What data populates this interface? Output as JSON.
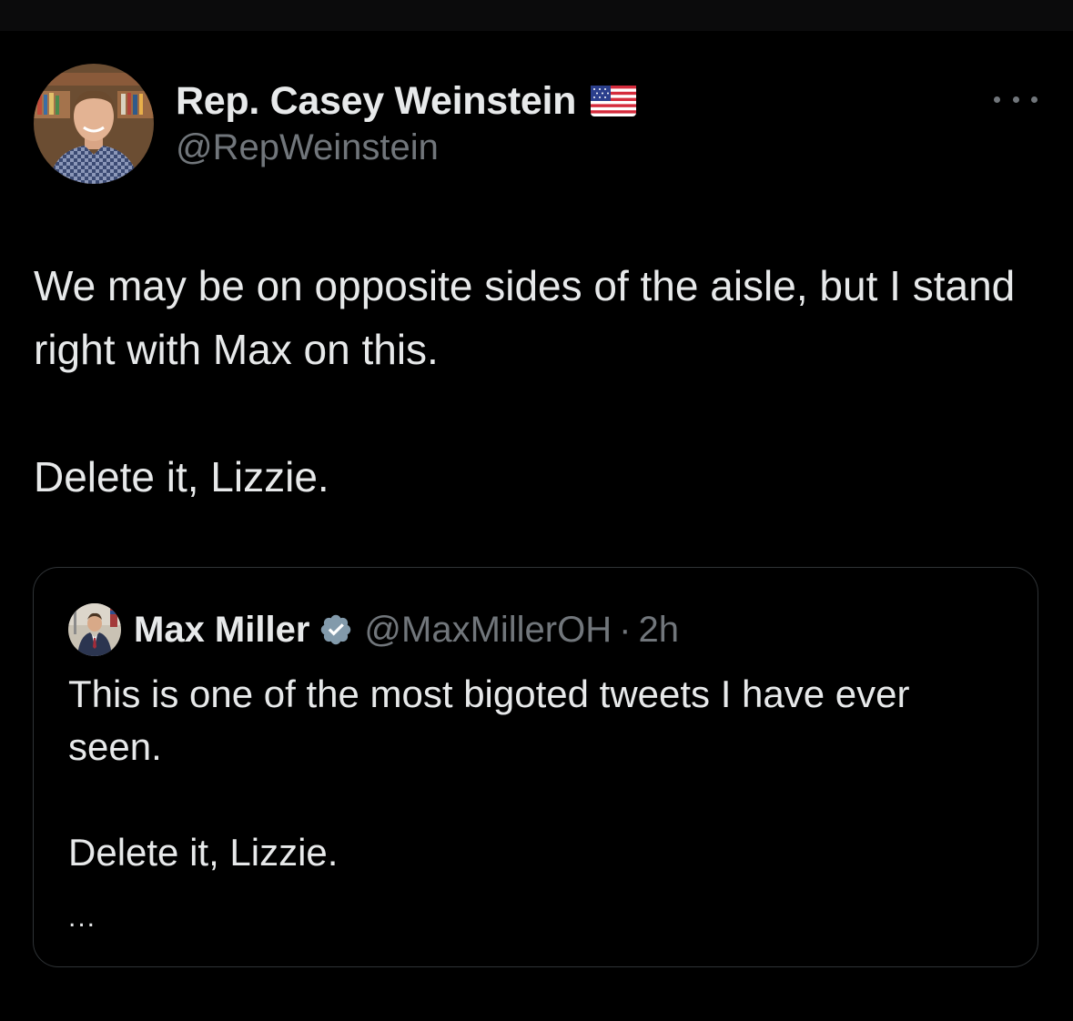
{
  "tweet": {
    "author": {
      "display_name": "Rep. Casey Weinstein",
      "handle": "@RepWeinstein",
      "badge_emoji": "us-flag-icon"
    },
    "text": "We may be on opposite sides of the aisle, but I stand right with Max on this.\n\nDelete it, Lizzie.",
    "more_icon": "more-horizontal-icon"
  },
  "quote": {
    "author": {
      "display_name": "Max Miller",
      "handle": "@MaxMillerOH",
      "separator": "·",
      "time": "2h",
      "verified_icon": "verified-badge-icon"
    },
    "text": "This is one of the most bigoted tweets I have ever seen.\n\nDelete it, Lizzie.",
    "ellipsis": "..."
  },
  "colors": {
    "background": "#000000",
    "text_primary": "#e7e9ea",
    "text_secondary": "#71767b",
    "border": "#2f3336",
    "verified_badge": "#829aab"
  }
}
